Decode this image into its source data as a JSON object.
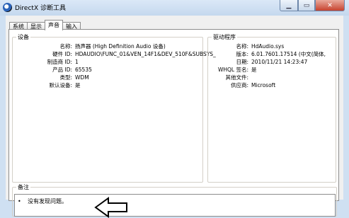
{
  "window": {
    "title": "DirectX 诊断工具"
  },
  "tabs": [
    "系统",
    "显示",
    "声音",
    "输入"
  ],
  "device": {
    "group_label": "设备",
    "rows": [
      {
        "key": "名称:",
        "value": "扬声器 (High Definition Audio 设备)"
      },
      {
        "key": "硬件 ID:",
        "value": "HDAUDIO\\FUNC_01&VEN_14F1&DEV_510F&SUBSYS_"
      },
      {
        "key": "制造商 ID:",
        "value": "1"
      },
      {
        "key": "产品 ID:",
        "value": "65535"
      },
      {
        "key": "类型:",
        "value": "WDM"
      },
      {
        "key": "默认设备:",
        "value": "是"
      }
    ]
  },
  "driver": {
    "group_label": "驱动程序",
    "rows": [
      {
        "key": "名称:",
        "value": "HdAudio.sys"
      },
      {
        "key": "版本:",
        "value": "6.01.7601.17514 (中文(简体,"
      },
      {
        "key": "日期:",
        "value": "2010/11/21 14:23:47"
      },
      {
        "key": "WHQL 签名:",
        "value": "是"
      },
      {
        "key": "其他文件:",
        "value": ""
      },
      {
        "key": "供应商:",
        "value": "Microsoft"
      }
    ]
  },
  "notes": {
    "group_label": "备注",
    "bullet": "•",
    "items": [
      "没有发现问题。"
    ]
  }
}
